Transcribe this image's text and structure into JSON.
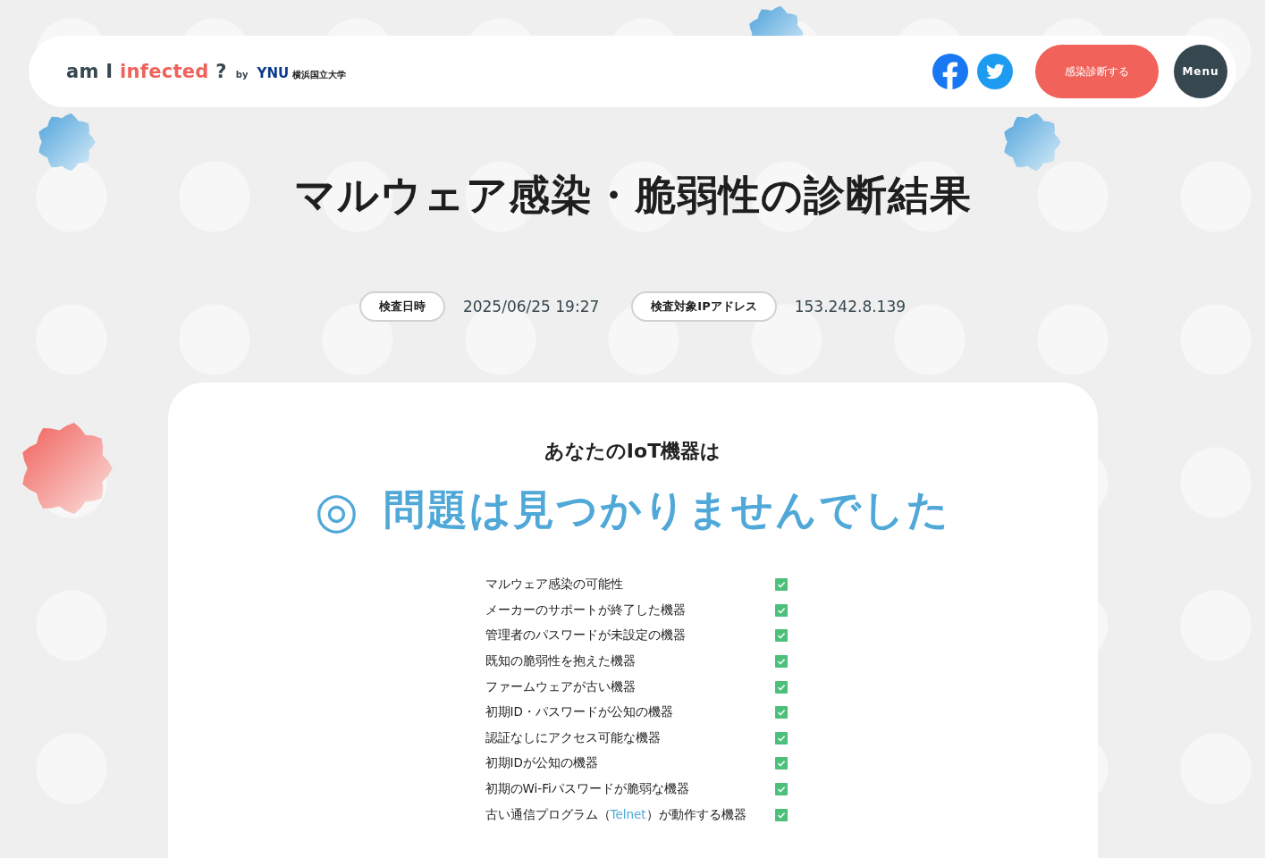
{
  "header": {
    "logo": {
      "prefix": "am I",
      "accent": "infected",
      "suffix": "?"
    },
    "by": "by",
    "university": {
      "abbr": "YNU",
      "name": "横浜国立大学"
    },
    "social": [
      {
        "kind": "facebook"
      },
      {
        "kind": "twitter"
      }
    ],
    "cta": "感染診断する",
    "menu": "Menu"
  },
  "title": "マルウェア感染・脆弱性の診断結果",
  "meta": [
    {
      "label": "検査日時",
      "value": "2025/06/25 19:27"
    },
    {
      "label": "検査対象IPアドレス",
      "value": "153.242.8.139"
    }
  ],
  "result": {
    "lead": "あなたのIoT機器は",
    "mark": "◎",
    "message": "問題は見つかりませんでした"
  },
  "checks": [
    {
      "segments": [
        {
          "kind": "plain",
          "text": "マルウェア感染の可能性"
        }
      ],
      "checked": true
    },
    {
      "segments": [
        {
          "kind": "plain",
          "text": "メーカーのサポートが終了した機器"
        }
      ],
      "checked": true
    },
    {
      "segments": [
        {
          "kind": "plain",
          "text": "管理者のパスワードが未設定の機器"
        }
      ],
      "checked": true
    },
    {
      "segments": [
        {
          "kind": "plain",
          "text": "既知の脆弱性を抱えた機器"
        }
      ],
      "checked": true
    },
    {
      "segments": [
        {
          "kind": "plain",
          "text": "ファームウェアが古い機器"
        }
      ],
      "checked": true
    },
    {
      "segments": [
        {
          "kind": "plain",
          "text": "初期ID・パスワードが公知の機器"
        }
      ],
      "checked": true
    },
    {
      "segments": [
        {
          "kind": "plain",
          "text": "認証なしにアクセス可能な機器"
        }
      ],
      "checked": true
    },
    {
      "segments": [
        {
          "kind": "plain",
          "text": "初期IDが公知の機器"
        }
      ],
      "checked": true
    },
    {
      "segments": [
        {
          "kind": "plain",
          "text": "初期のWi-Fiパスワードが脆弱な機器"
        }
      ],
      "checked": true
    },
    {
      "segments": [
        {
          "kind": "plain",
          "text": "古い通信プログラム（"
        },
        {
          "kind": "highlight",
          "text": "Telnet"
        },
        {
          "kind": "plain",
          "text": "）が動作する機器"
        }
      ],
      "checked": true
    }
  ]
}
